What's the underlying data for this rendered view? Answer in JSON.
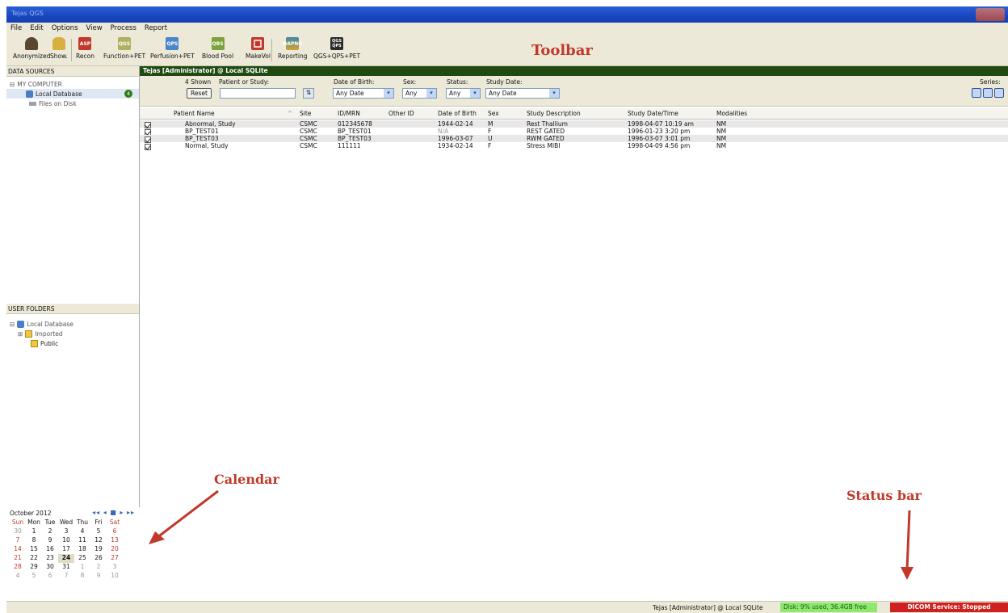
{
  "window": {
    "title": "Tejas QGS"
  },
  "menu": [
    "File",
    "Edit",
    "Options",
    "View",
    "Process",
    "Report"
  ],
  "toolbar": {
    "items": [
      {
        "label": "Anonymized",
        "icon": "anonymize-icon",
        "color": "#5a4630"
      },
      {
        "label": "Show.",
        "icon": "lock-icon",
        "color": "#c99a20"
      },
      {
        "label": "Recon",
        "icon": "recon-icon",
        "color": "#c0392b"
      },
      {
        "label": "Function+PET",
        "icon": "function-pet-icon",
        "color": "#8aa84a"
      },
      {
        "label": "Perfusion+PET",
        "icon": "perfusion-pet-icon",
        "color": "#4a86c8"
      },
      {
        "label": "Blood Pool",
        "icon": "blood-pool-icon",
        "color": "#7aa33a"
      },
      {
        "label": "MakeVol",
        "icon": "makevol-icon",
        "color": "#c0392b"
      },
      {
        "label": "Reporting",
        "icon": "reporting-icon",
        "color": "#3a8aa8"
      },
      {
        "label": "QGS+QPS+PET",
        "icon": "qgs-qps-pet-icon",
        "color": "#2a2a2a"
      }
    ],
    "icon_texts": [
      "",
      "",
      "ASP",
      "QGS",
      "QPS",
      "QBS",
      "",
      "DAPNG",
      "QGS QPS"
    ],
    "annotation": "Toolbar"
  },
  "sidebar": {
    "data_sources_header": "DATA SOURCES",
    "my_computer": "MY COMPUTER",
    "local_database": "Local Database",
    "local_database_count": "4",
    "files_on_disk": "Files on Disk",
    "user_folders_header": "USER FOLDERS",
    "uf_local_database": "Local Database",
    "imported": "Imported",
    "public": "Public"
  },
  "main": {
    "panel_title": "Tejas [Administrator] @ Local SQLite",
    "shown": "4 Shown",
    "reset_label": "Reset",
    "patient_label": "Patient or Study:",
    "patient_value": "",
    "dob_label": "Date of Birth:",
    "dob_value": "Any Date",
    "sex_label": "Sex:",
    "sex_value": "Any",
    "status_label": "Status:",
    "status_value": "Any",
    "study_date_label": "Study Date:",
    "study_date_value": "Any Date",
    "series_label": "Series:"
  },
  "table": {
    "columns": [
      "Patient Name",
      "Site",
      "ID/MRN",
      "Other ID",
      "Date of Birth",
      "Sex",
      "Study Description",
      "Study Date/Time",
      "Modalities"
    ],
    "rows": [
      [
        "Abnormal, Study",
        "CSMC",
        "012345678",
        "",
        "1944-02-14",
        "M",
        "Rest Thallium",
        "1998-04-07 10:19 am",
        "NM"
      ],
      [
        "BP_TEST01",
        "CSMC",
        "BP_TEST01",
        "",
        "N/A",
        "F",
        "REST GATED",
        "1996-01-23 3:20 pm",
        "NM"
      ],
      [
        "BP_TEST03",
        "CSMC",
        "BP_TEST03",
        "",
        "1996-03-07",
        "U",
        "RWM GATED",
        "1996-03-07 3:01 pm",
        "NM"
      ],
      [
        "Normal, Study",
        "CSMC",
        "111111",
        "",
        "1934-02-14",
        "F",
        "Stress MIBI",
        "1998-04-09 4:56 pm",
        "NM"
      ]
    ]
  },
  "calendar": {
    "month": "October 2012",
    "weekdays": [
      "Sun",
      "Mon",
      "Tue",
      "Wed",
      "Thu",
      "Fri",
      "Sat"
    ],
    "weeks": [
      [
        "30",
        "1",
        "2",
        "3",
        "4",
        "5",
        "6"
      ],
      [
        "7",
        "8",
        "9",
        "10",
        "11",
        "12",
        "13"
      ],
      [
        "14",
        "15",
        "16",
        "17",
        "18",
        "19",
        "20"
      ],
      [
        "21",
        "22",
        "23",
        "24",
        "25",
        "26",
        "27"
      ],
      [
        "28",
        "29",
        "30",
        "31",
        "1",
        "2",
        "3"
      ],
      [
        "4",
        "5",
        "6",
        "7",
        "8",
        "9",
        "10"
      ]
    ],
    "today": "24",
    "annotation": "Calendar"
  },
  "status": {
    "user": "Tejas [Administrator] @ Local SQLite",
    "disk": "Disk: 9% used, 36.4GB free",
    "dicom": "DICOM Service: Stopped",
    "annotation": "Status bar"
  },
  "colors": {
    "accent_red": "#c0392b",
    "disk_green": "#8ee86b",
    "dicom_red": "#d02020",
    "panel_green": "#1f4a10"
  }
}
